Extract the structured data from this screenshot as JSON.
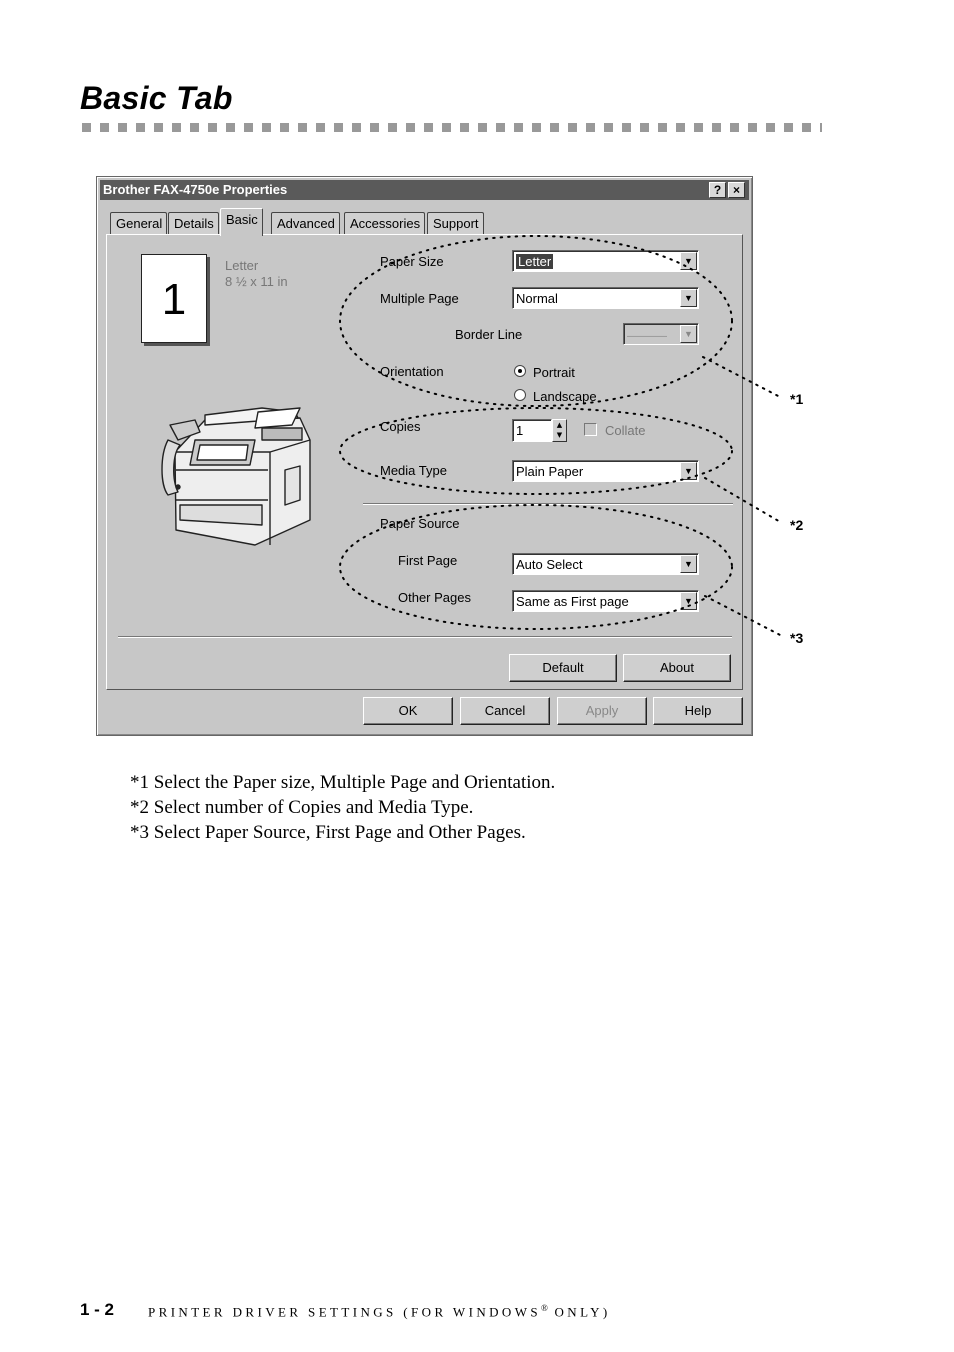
{
  "heading": "Basic Tab",
  "dialog": {
    "title": "Brother FAX-4750e Properties",
    "help_button": "?",
    "close_button": "×",
    "tabs": [
      {
        "label": "General"
      },
      {
        "label": "Details"
      },
      {
        "label": "Basic"
      },
      {
        "label": "Advanced"
      },
      {
        "label": "Accessories"
      },
      {
        "label": "Support"
      }
    ],
    "preview": {
      "page_number": "1",
      "paper_name": "Letter",
      "paper_dims": "8 ½ x 11 in"
    },
    "paper_size": {
      "label": "Paper Size",
      "value": "Letter"
    },
    "multiple_page": {
      "label": "Multiple Page",
      "value": "Normal"
    },
    "border_line": {
      "label": "Border Line",
      "value": "————"
    },
    "orientation": {
      "label": "Orientation",
      "portrait": "Portrait",
      "landscape": "Landscape",
      "selected": "Portrait"
    },
    "copies": {
      "label": "Copies",
      "value": "1",
      "collate": "Collate"
    },
    "media_type": {
      "label": "Media Type",
      "value": "Plain Paper"
    },
    "paper_source": {
      "label": "Paper Source",
      "first_page_label": "First Page",
      "first_page_value": "Auto Select",
      "other_pages_label": "Other Pages",
      "other_pages_value": "Same as First page"
    },
    "buttons": {
      "default": "Default",
      "about": "About",
      "ok": "OK",
      "cancel": "Cancel",
      "apply": "Apply",
      "help": "Help"
    }
  },
  "callouts": [
    "*1",
    "*2",
    "*3"
  ],
  "notes": [
    "*1  Select the Paper size, Multiple Page and Orientation.",
    "*2  Select number of Copies and Media Type.",
    "*3  Select Paper Source, First Page and Other Pages."
  ],
  "footer": {
    "page_number": "1 - 2",
    "text": "PRINTER DRIVER SETTINGS (FOR WINDOWS",
    "registered": "®",
    "text_end": " ONLY)"
  }
}
